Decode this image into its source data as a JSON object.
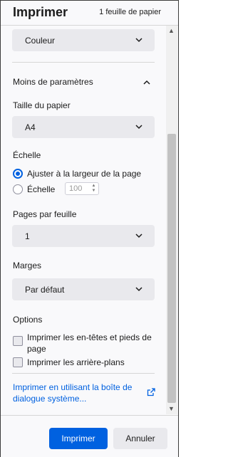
{
  "header": {
    "title": "Imprimer",
    "sheet_count": "1 feuille de papier"
  },
  "color_select": {
    "value": "Couleur"
  },
  "more_settings": {
    "label": "Moins de paramètres"
  },
  "paper_size": {
    "label": "Taille du papier",
    "value": "A4"
  },
  "scale": {
    "label": "Échelle",
    "fit_option": "Ajuster à la largeur de la page",
    "scale_option": "Échelle",
    "scale_value": "100"
  },
  "pages_per_sheet": {
    "label": "Pages par feuille",
    "value": "1"
  },
  "margins": {
    "label": "Marges",
    "value": "Par défaut"
  },
  "options": {
    "label": "Options",
    "headers_footers_line1": "Imprimer les en-têtes et pieds de",
    "headers_footers_line2": "page",
    "backgrounds": "Imprimer les arrière-plans"
  },
  "system_dialog": {
    "line1": "Imprimer en utilisant la boîte de",
    "line2": "dialogue système..."
  },
  "footer": {
    "print_label": "Imprimer",
    "cancel_label": "Annuler"
  },
  "colors": {
    "accent": "#0061e0",
    "select_bg": "#e9e9ed"
  }
}
